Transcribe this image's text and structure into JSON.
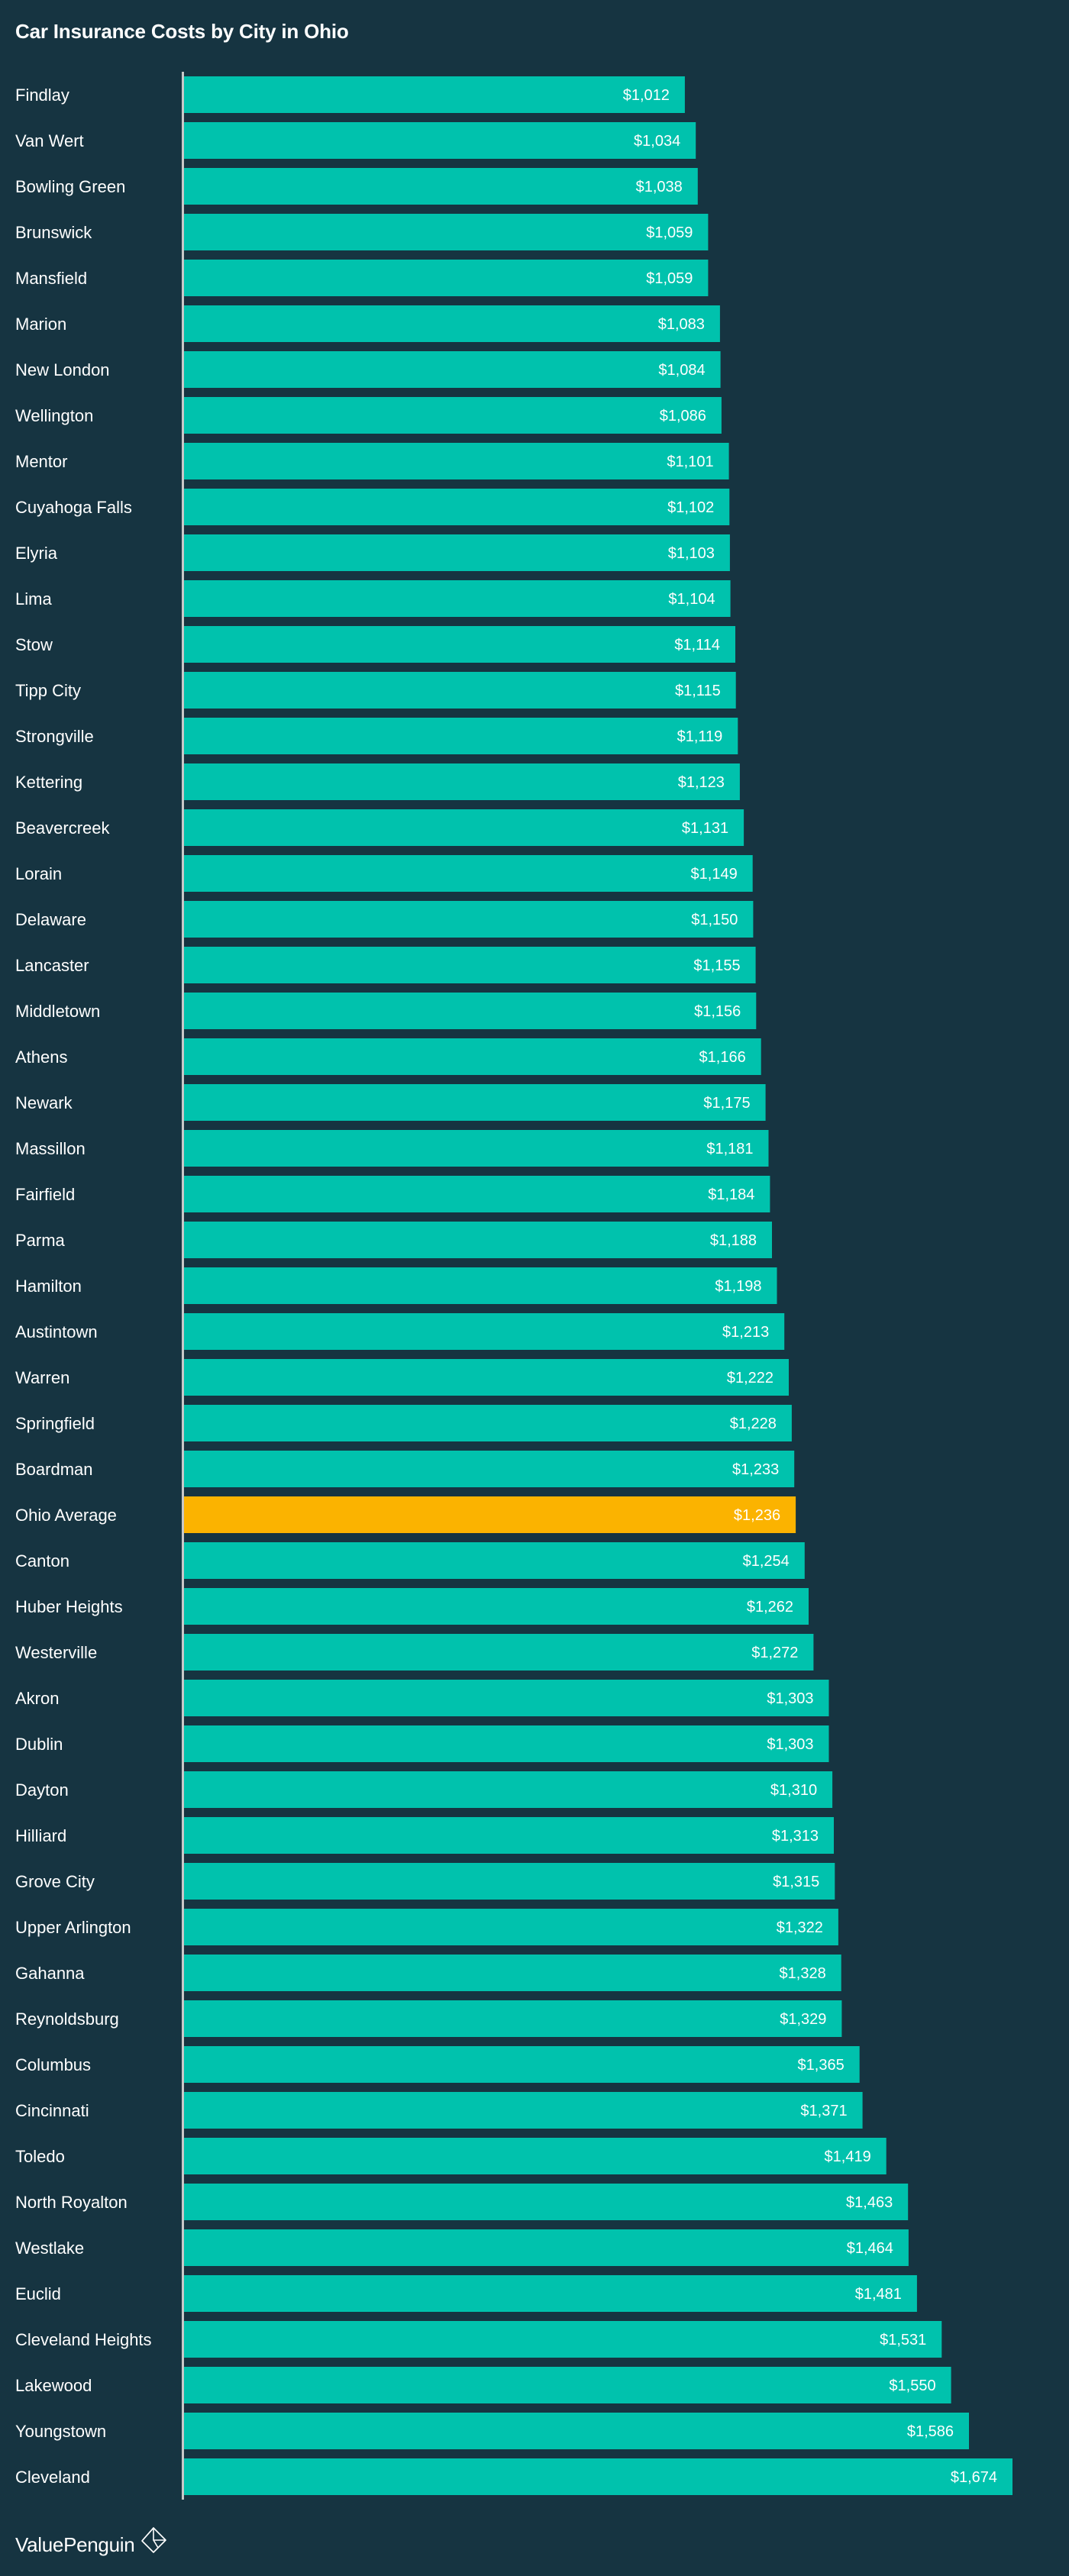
{
  "chart_data": {
    "type": "bar",
    "orientation": "horizontal",
    "title": "Car Insurance Costs by City in Ohio",
    "xlabel": "",
    "ylabel": "",
    "value_prefix": "$",
    "xlim": [
      0,
      1800
    ],
    "grid": false,
    "legend": "none",
    "categories": [
      "Findlay",
      "Van Wert",
      "Bowling Green",
      "Brunswick",
      "Mansfield",
      "Marion",
      "New London",
      "Wellington",
      "Mentor",
      "Cuyahoga Falls",
      "Elyria",
      "Lima",
      "Stow",
      "Tipp City",
      "Strongville",
      "Kettering",
      "Beavercreek",
      "Lorain",
      "Delaware",
      "Lancaster",
      "Middletown",
      "Athens",
      "Newark",
      "Massillon",
      "Fairfield",
      "Parma",
      "Hamilton",
      "Austintown",
      "Warren",
      "Springfield",
      "Boardman",
      "Ohio Average",
      "Canton",
      "Huber Heights",
      "Westerville",
      "Akron",
      "Dublin",
      "Dayton",
      "Hilliard",
      "Grove City",
      "Upper Arlington",
      "Gahanna",
      "Reynoldsburg",
      "Columbus",
      "Cincinnati",
      "Toledo",
      "North Royalton",
      "Westlake",
      "Euclid",
      "Cleveland Heights",
      "Lakewood",
      "Youngstown",
      "Cleveland"
    ],
    "values": [
      1012,
      1034,
      1038,
      1059,
      1059,
      1083,
      1084,
      1086,
      1101,
      1102,
      1103,
      1104,
      1114,
      1115,
      1119,
      1123,
      1131,
      1149,
      1150,
      1155,
      1156,
      1166,
      1175,
      1181,
      1184,
      1188,
      1198,
      1213,
      1222,
      1228,
      1233,
      1236,
      1254,
      1262,
      1272,
      1303,
      1303,
      1310,
      1313,
      1315,
      1322,
      1328,
      1329,
      1365,
      1371,
      1419,
      1463,
      1464,
      1481,
      1531,
      1550,
      1586,
      1674
    ],
    "highlight_category": "Ohio Average",
    "colors": {
      "bar": "#00c2ad",
      "highlight": "#fbb300",
      "axis": "#c8c8c8",
      "background": "#163441"
    }
  },
  "footer": {
    "brand": "ValuePenguin",
    "logo_icon": "valuepenguin-diamond-logo-icon"
  }
}
